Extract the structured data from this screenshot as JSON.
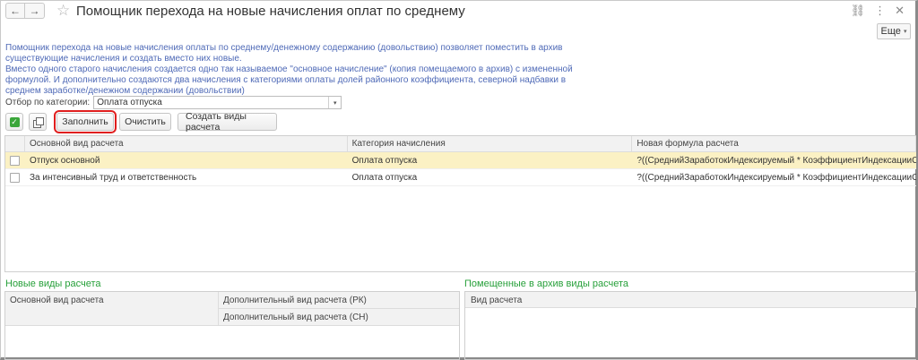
{
  "window": {
    "title": "Помощник перехода на новые начисления оплат по среднему",
    "back_icon": "←",
    "forward_icon": "→",
    "star_icon": "☆",
    "link_icon": "⛓",
    "menu_icon": "⋮",
    "close_icon": "✕"
  },
  "more_button": {
    "label": "Еще",
    "caret": "▾"
  },
  "description": {
    "line1": "Помощник перехода на новые начисления оплаты по среднему/денежному содержанию (довольствию) позволяет поместить в архив существующие начисления и создать вместо них новые.",
    "line2": "Вместо одного старого начисления создается одно так называемое \"основное начисление\" (копия помещаемого в архив) с измененной формулой. И дополнительно создаются два начисления с категориями оплаты долей районного коэффициента, северной надбавки в среднем заработке/денежном содержании (довольствии)"
  },
  "filter": {
    "label": "Отбор по категории:",
    "value": "Оплата отпуска",
    "drop_icon": "▾"
  },
  "toolbar": {
    "check_all_icon": "✓",
    "fill_label": "Заполнить",
    "clear_label": "Очистить",
    "create_label": "Создать виды расчета"
  },
  "main_table": {
    "headers": [
      "Основной вид расчета",
      "Категория начисления",
      "Новая формула расчета"
    ],
    "rows": [
      {
        "name": "Отпуск основной",
        "category": "Оплата отпуска",
        "formula": "?((СреднийЗаработокИндексируемый * КоэффициентИндексацииСред..."
      },
      {
        "name": "За интенсивный труд и ответственность",
        "category": "Оплата отпуска",
        "formula": "?((СреднийЗаработокИндексируемый * КоэффициентИндексацииСред..."
      }
    ]
  },
  "new_types": {
    "title": "Новые виды расчета",
    "col_main": "Основной вид расчета",
    "col_rk": "Дополнительный вид расчета (РК)",
    "col_sn": "Дополнительный вид расчета (СН)"
  },
  "archived_types": {
    "title": "Помещенные в архив виды расчета",
    "col_name": "Вид расчета"
  },
  "colors": {
    "description_text": "#4f6ab7",
    "section_title": "#27a03a",
    "selected_row": "#fbf1c4",
    "highlight_outline": "#e01e1e"
  }
}
